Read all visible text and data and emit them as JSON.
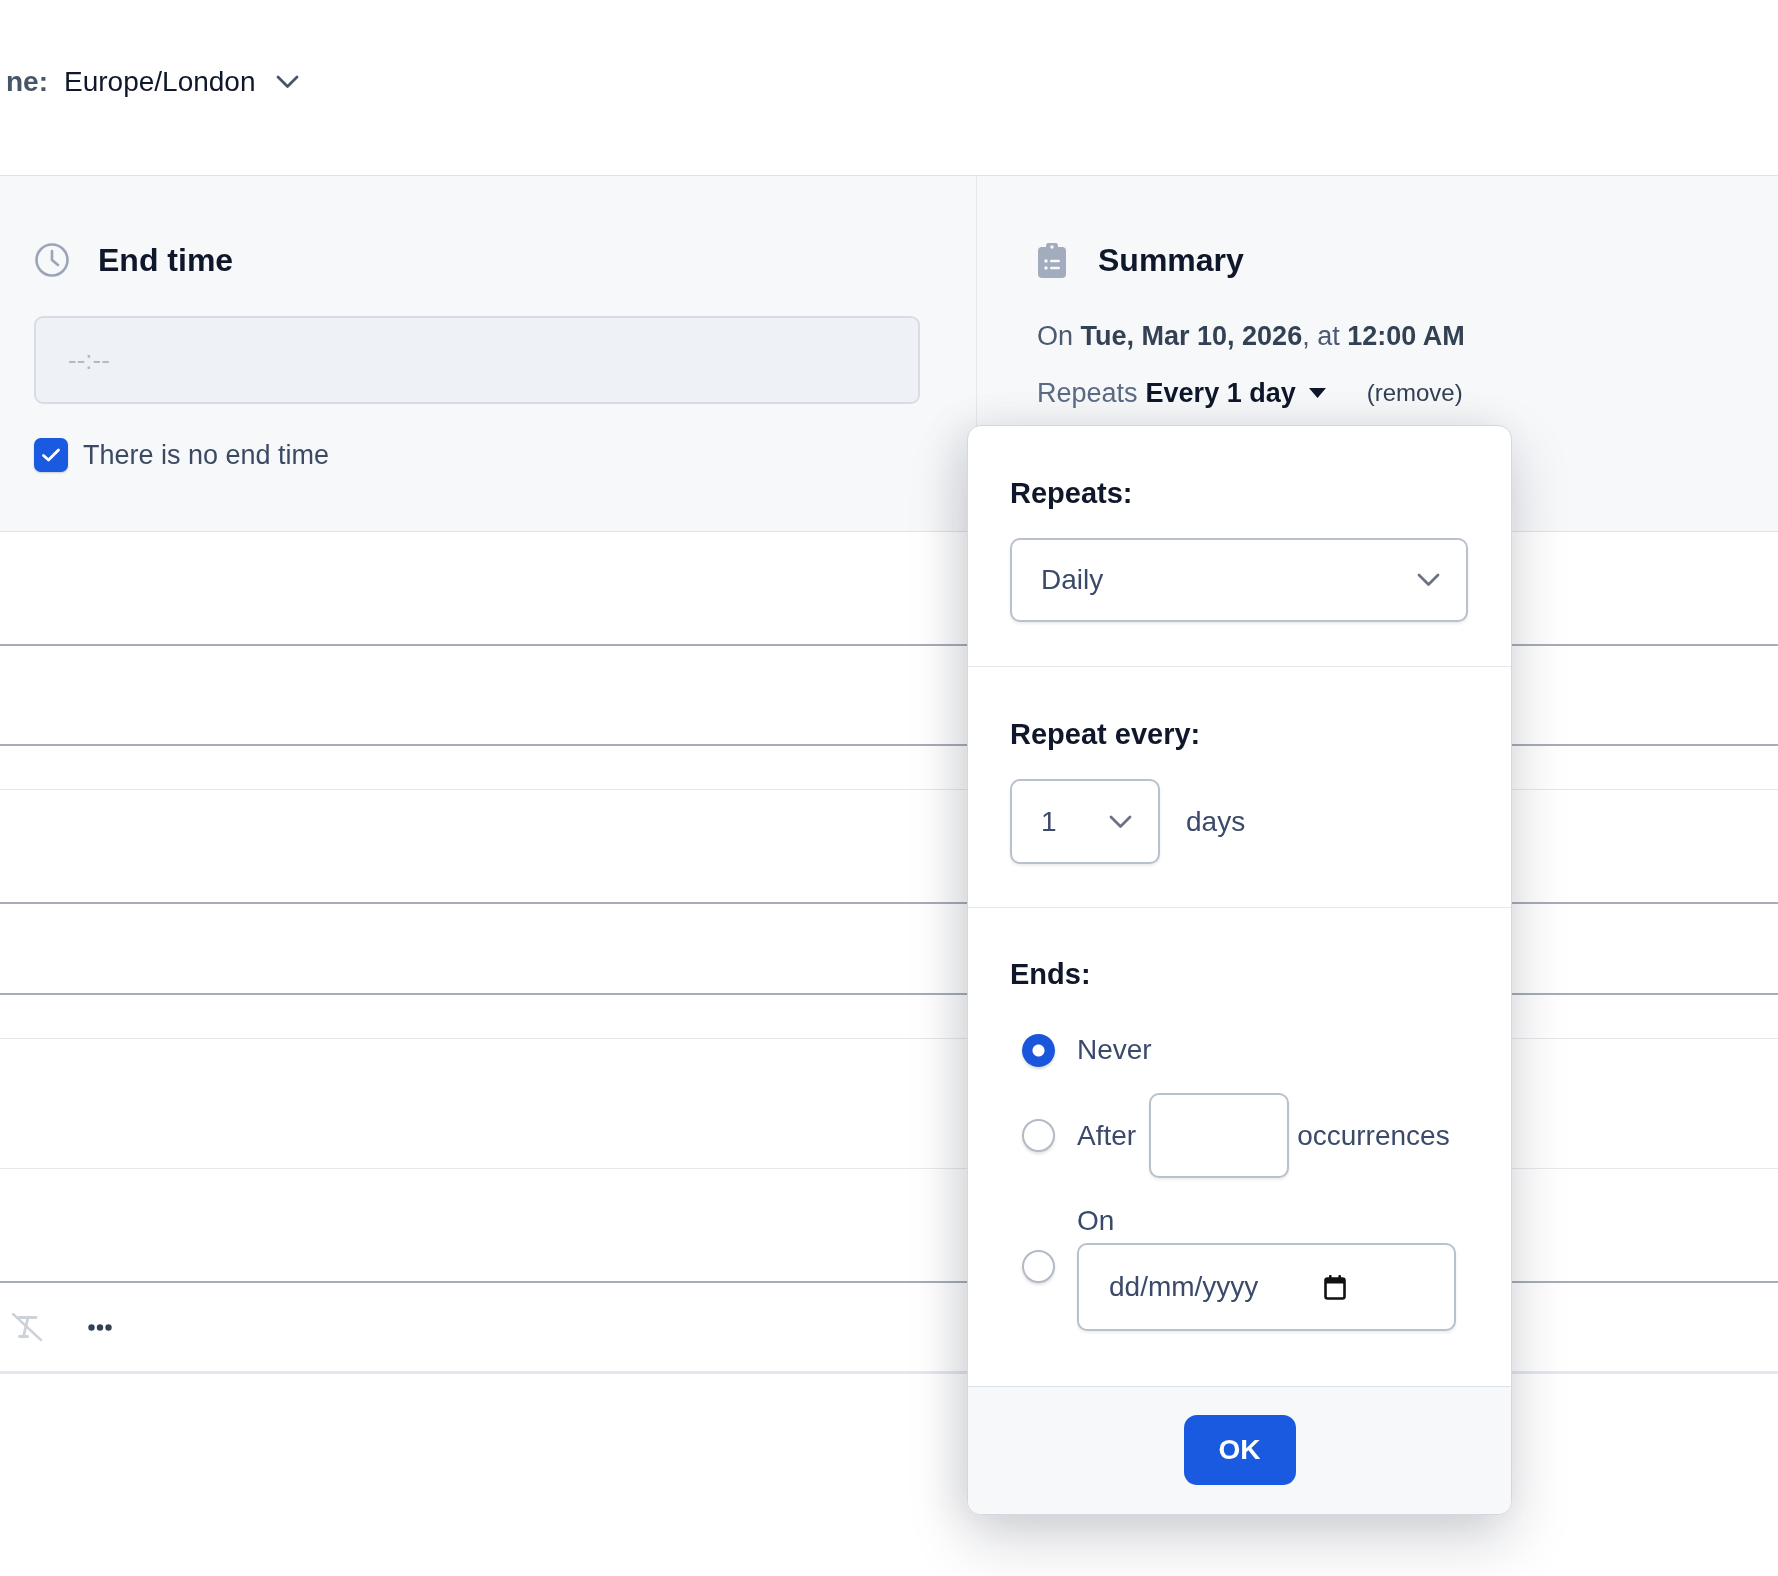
{
  "timezone": {
    "label": "ne:",
    "value": "Europe/London"
  },
  "end_time": {
    "title": "End time",
    "time_field": {
      "placeholder": "--:--"
    },
    "no_end_time": {
      "label": "There is no end time",
      "checked": true
    }
  },
  "summary": {
    "title": "Summary",
    "date_line": "On **Tue, Mar 10, 2026**, at **12:00 AM**",
    "repeats": {
      "label": "Repeats",
      "value": "Every 1 day",
      "remove_link": "(remove)"
    }
  },
  "editor_toolbar": [
    {
      "kind": "clear-format",
      "disabled": true
    },
    {
      "kind": "more",
      "disabled": false
    }
  ],
  "repeat_popup": {
    "frequency": {
      "label": "Repeats:",
      "value": "Daily"
    },
    "interval": {
      "label": "Repeat every:",
      "value": "1",
      "unit": "days"
    },
    "ends": {
      "label": "Ends:",
      "options": [
        {
          "kind": "never",
          "label": "Never",
          "selected": true
        },
        {
          "kind": "after",
          "label": "After",
          "suffix": "occurrences",
          "selected": false
        },
        {
          "kind": "on",
          "label": "On",
          "date_field": {
            "placeholder": "dd/mm/yyyy"
          },
          "selected": false
        }
      ]
    },
    "ok_button": "OK"
  }
}
